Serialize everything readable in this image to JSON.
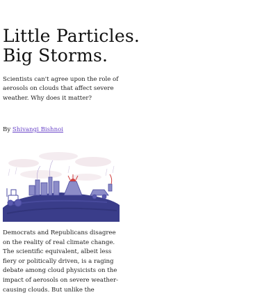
{
  "article": {
    "title_line1": "Little Particles.",
    "title_line2": "Big Storms.",
    "subtitle": "Scientists can't agree upon the role of aerosols on clouds that affect severe weather. Why does it matter?",
    "byline_prefix": "By ",
    "author": "Shivangi Bishnoi",
    "body": "Democrats and Republicans disagree on the reality of real climate change. The scientific equivalent, albeit less fiery or politically driven, is a raging debate among cloud physicists on the impact of aerosols on severe weather-causing clouds. But unlike the"
  },
  "hero_image": {
    "icon": "illustrated-earth-with-factories-volcano-and-vehicles",
    "colors": {
      "earth": "#3a3d8a",
      "ink": "#4a4aa0",
      "smoke": "#d8b8c8",
      "fire": "#d04040"
    }
  },
  "colors": {
    "link": "#6a45c8",
    "text": "#111111"
  }
}
